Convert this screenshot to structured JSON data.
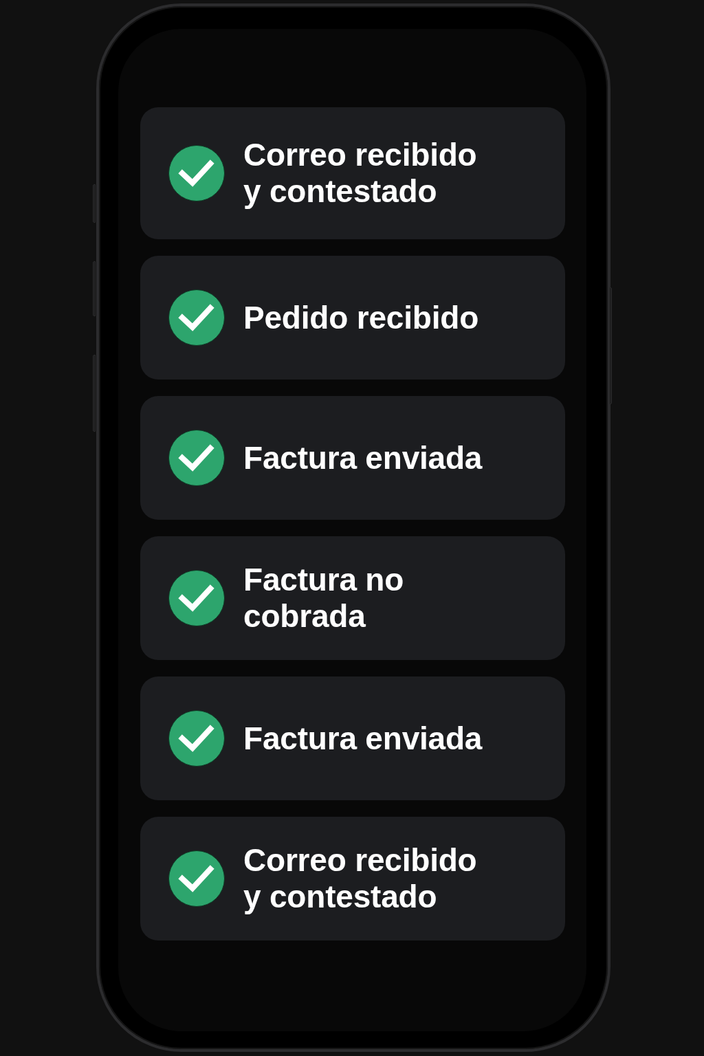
{
  "screen": {
    "items": [
      {
        "label": "Correo recibido y contestado",
        "checked": true
      },
      {
        "label": "Pedido recibido",
        "checked": true
      },
      {
        "label": "Factura enviada",
        "checked": true
      },
      {
        "label": "Factura no cobrada",
        "checked": true
      },
      {
        "label": "Factura enviada",
        "checked": true
      },
      {
        "label": "Correo recibido y contestado",
        "checked": true
      }
    ]
  }
}
